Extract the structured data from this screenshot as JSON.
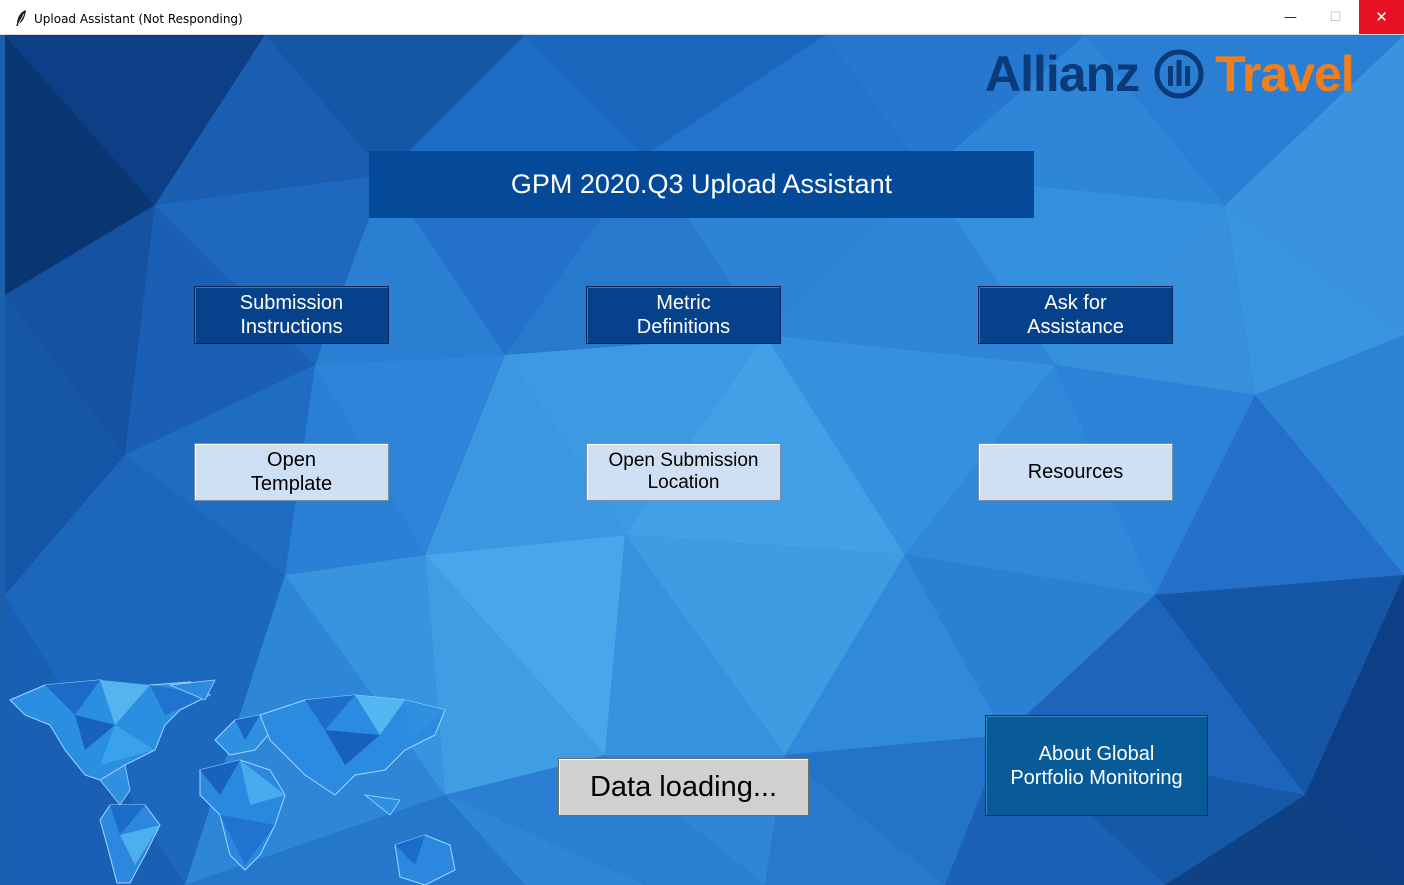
{
  "window": {
    "title": "Upload Assistant (Not Responding)",
    "icon": "feather-icon",
    "controls": {
      "minimize": "—",
      "maximize": "☐",
      "close": "✕"
    }
  },
  "logo": {
    "brand": "Allianz",
    "product": "Travel"
  },
  "header": {
    "title": "GPM 2020.Q3 Upload Assistant"
  },
  "buttons": {
    "submission_instructions": "Submission\nInstructions",
    "metric_definitions": "Metric\nDefinitions",
    "ask_for_assistance": "Ask for\nAssistance",
    "open_template": "Open\nTemplate",
    "open_submission_location": "Open Submission\nLocation",
    "resources": "Resources",
    "data_loading": "Data loading...",
    "about": "About Global\nPortfolio Monitoring"
  },
  "colors": {
    "background": "#1b5faf",
    "dark_button": "#06428c",
    "light_button": "#cfe0f4",
    "close_button": "#e81123",
    "allianz_blue": "#0a3a78",
    "travel_orange": "#f07e1b"
  }
}
